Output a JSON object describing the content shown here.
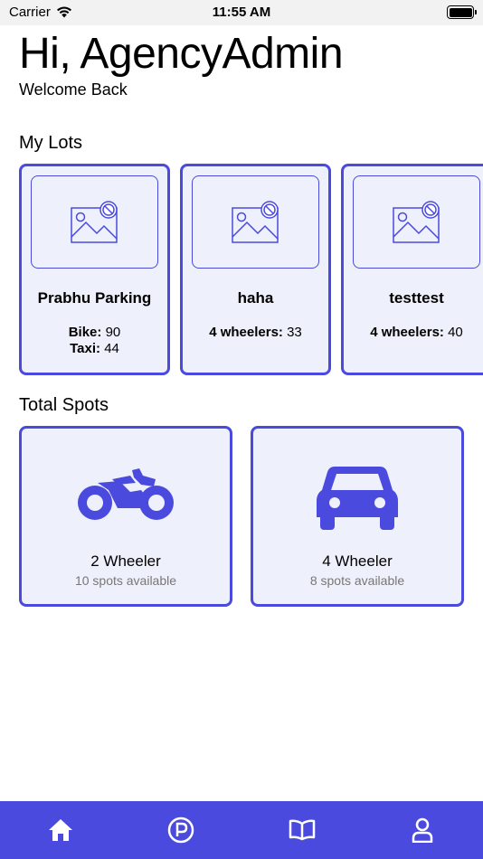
{
  "status_bar": {
    "carrier": "Carrier",
    "time": "11:55 AM"
  },
  "header": {
    "greeting": "Hi, AgencyAdmin",
    "subtitle": "Welcome Back"
  },
  "my_lots": {
    "title": "My Lots",
    "lots": [
      {
        "name": "Prabhu Parking",
        "lines": [
          {
            "label": "Bike:",
            "value": "90"
          },
          {
            "label": "Taxi:",
            "value": "44"
          }
        ]
      },
      {
        "name": "haha",
        "lines": [
          {
            "label": "4 wheelers:",
            "value": "33"
          }
        ]
      },
      {
        "name": "testtest",
        "lines": [
          {
            "label": "4 wheelers:",
            "value": "40"
          }
        ]
      }
    ]
  },
  "total_spots": {
    "title": "Total Spots",
    "cards": [
      {
        "label": "2 Wheeler",
        "available": "10 spots available",
        "icon": "motorcycle-icon"
      },
      {
        "label": "4 Wheeler",
        "available": "8 spots available",
        "icon": "car-icon"
      }
    ]
  },
  "tab_bar": {
    "tabs": [
      "home-icon",
      "parking-icon",
      "book-icon",
      "user-icon"
    ]
  },
  "colors": {
    "accent": "#4a4adf",
    "card_bg": "#eef0fb",
    "muted_text": "#777777"
  }
}
